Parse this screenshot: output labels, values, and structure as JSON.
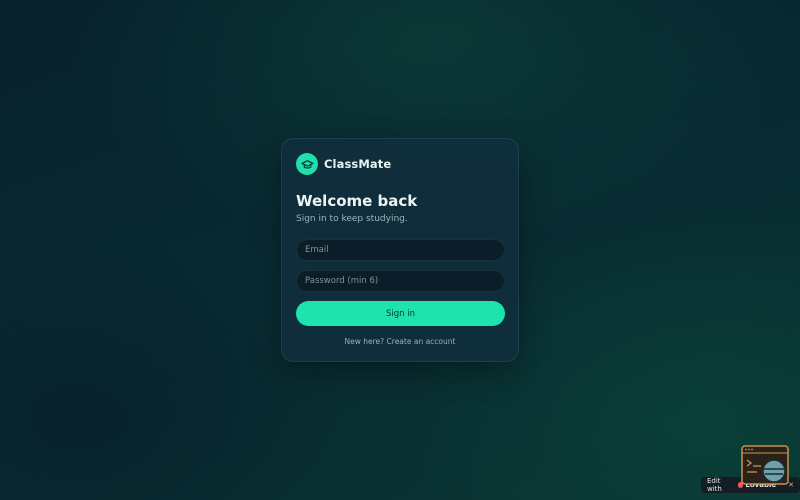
{
  "brand": {
    "logo_icon": "graduation-cap-icon",
    "name": "ClassMate"
  },
  "heading": {
    "title": "Welcome back",
    "subtitle": "Sign in to keep studying."
  },
  "form": {
    "email_placeholder": "Email",
    "email_value": "",
    "password_placeholder": "Password (min 6)",
    "password_value": "",
    "submit_label": "Sign in",
    "create_account_link": "New here? Create an account"
  },
  "badge": {
    "prefix": "Edit with",
    "brand": "Lovable",
    "close_label": "✕"
  },
  "colors": {
    "accent": "#1fe3ad",
    "card_bg": "#102e3c",
    "input_bg": "#0a1d29",
    "page_bg": "#082a32"
  }
}
